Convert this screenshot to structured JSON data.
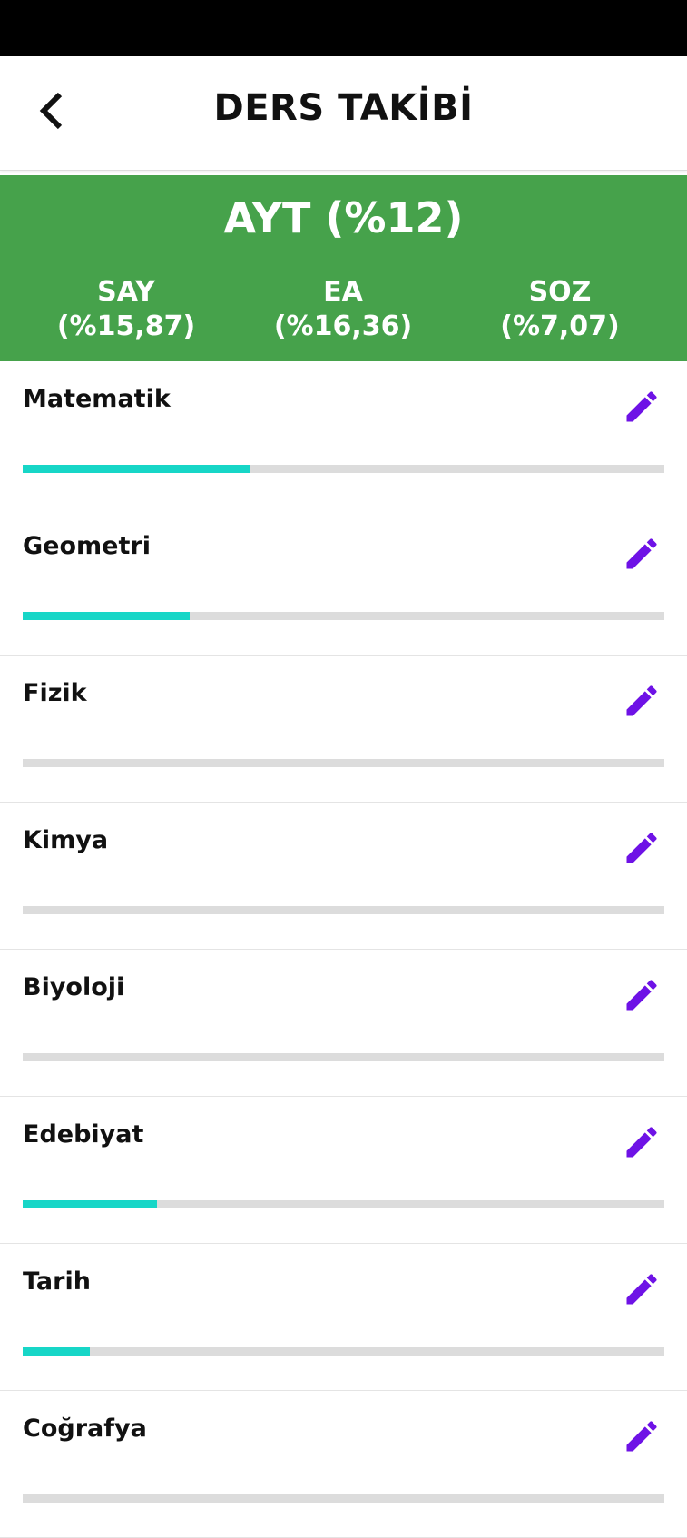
{
  "header": {
    "title": "DERS TAKİBİ",
    "back_icon": "chevron-left-icon"
  },
  "exam": {
    "title": "AYT (%12)",
    "scores": [
      {
        "label": "SAY",
        "value": "(%15,87)"
      },
      {
        "label": "EA",
        "value": "(%16,36)"
      },
      {
        "label": "SOZ",
        "value": "(%7,07)"
      }
    ],
    "background": "#46a24b"
  },
  "colors": {
    "progress_fill": "#17d6c7",
    "progress_track": "#dcdcdc",
    "edit_icon": "#6e12e6"
  },
  "subjects": [
    {
      "name": "Matematik",
      "progress": 0.355
    },
    {
      "name": "Geometri",
      "progress": 0.26
    },
    {
      "name": "Fizik",
      "progress": 0
    },
    {
      "name": "Kimya",
      "progress": 0
    },
    {
      "name": "Biyoloji",
      "progress": 0
    },
    {
      "name": "Edebiyat",
      "progress": 0.21
    },
    {
      "name": "Tarih",
      "progress": 0.105
    },
    {
      "name": "Coğrafya",
      "progress": 0
    }
  ],
  "edit_icon_name": "pencil-icon"
}
